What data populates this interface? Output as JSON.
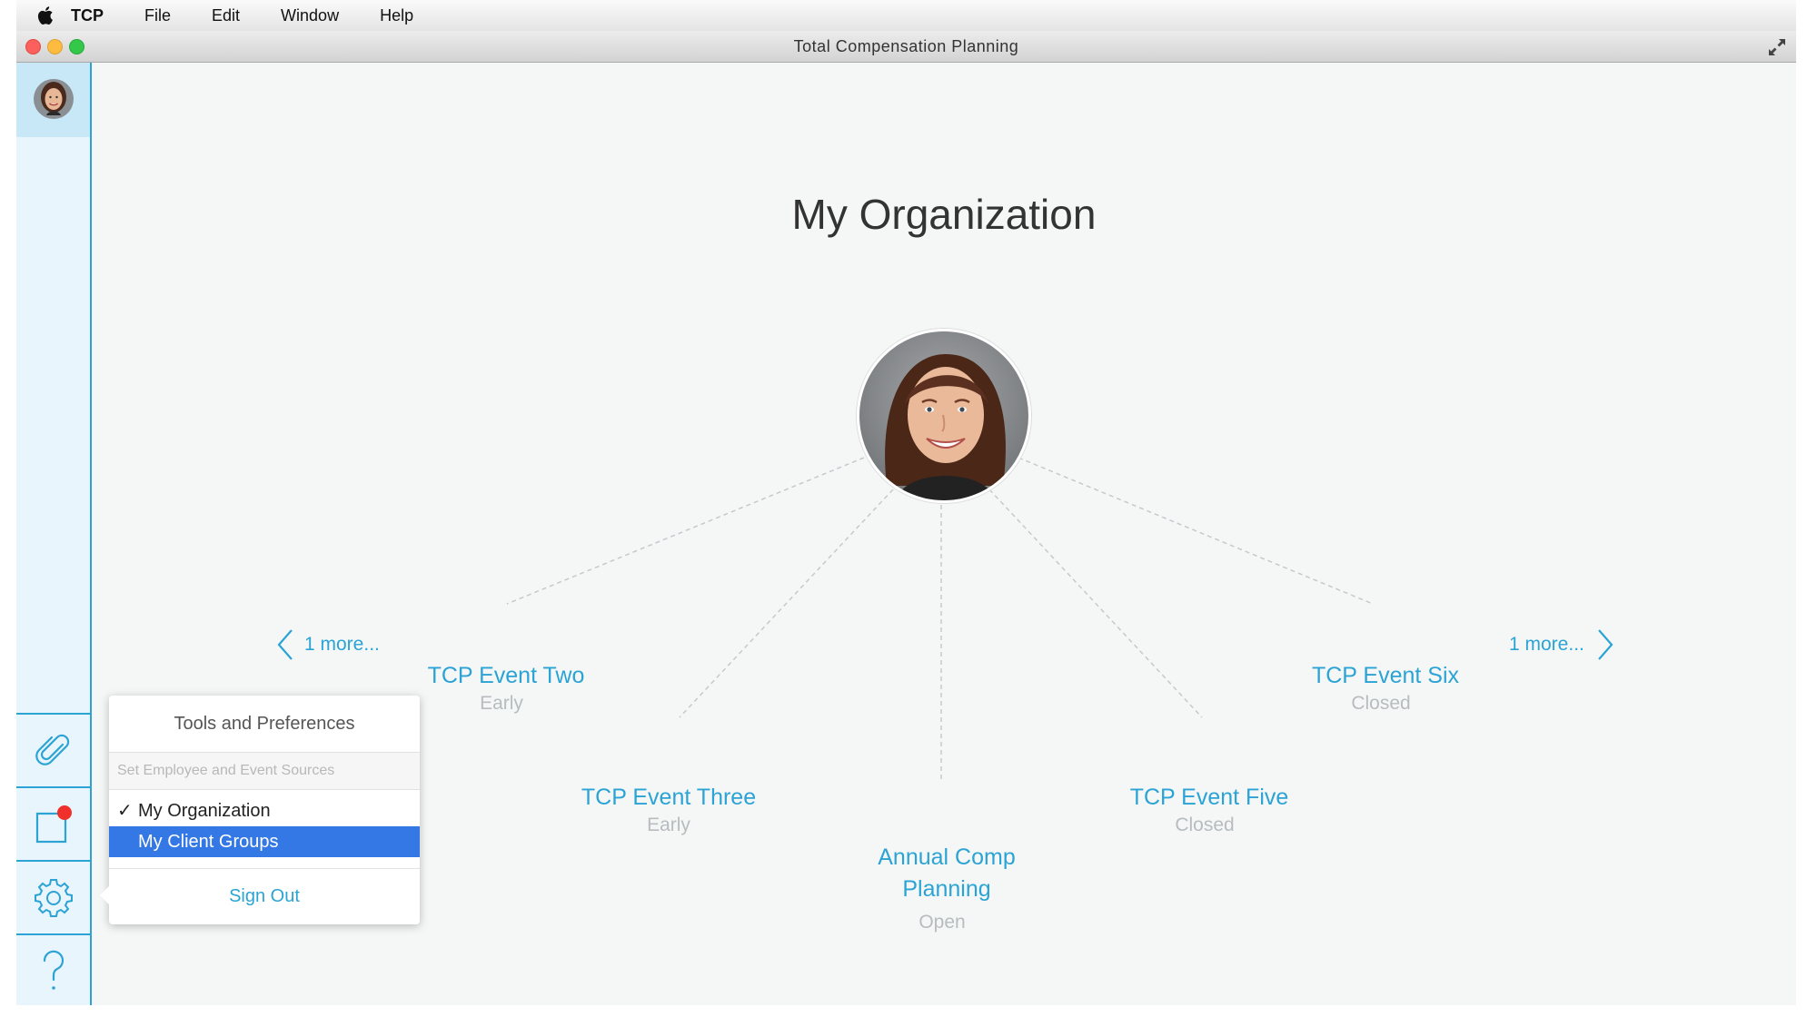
{
  "menubar": {
    "app_name": "TCP",
    "items": [
      {
        "label": "File"
      },
      {
        "label": "Edit"
      },
      {
        "label": "Window"
      },
      {
        "label": "Help"
      }
    ]
  },
  "window": {
    "title": "Total Compensation Planning"
  },
  "main": {
    "title": "My Organization",
    "events": [
      {
        "name": "TCP Event Two",
        "status": "Early"
      },
      {
        "name": "TCP Event Three",
        "status": "Early"
      },
      {
        "name": "Annual Comp",
        "name2": "Planning",
        "status": "Open"
      },
      {
        "name": "TCP Event Five",
        "status": "Closed"
      },
      {
        "name": "TCP Event Six",
        "status": "Closed"
      }
    ],
    "more_left": "1 more...",
    "more_right": "1 more..."
  },
  "popover": {
    "title": "Tools and Preferences",
    "section": "Set Employee and Event Sources",
    "items": [
      {
        "label": "My Organization",
        "check": "✓"
      },
      {
        "label": "My Client Groups"
      }
    ],
    "sign_out": "Sign Out"
  },
  "colors": {
    "accent": "#2ba3d4",
    "selection": "#3478e5",
    "badge": "#f0302b"
  }
}
